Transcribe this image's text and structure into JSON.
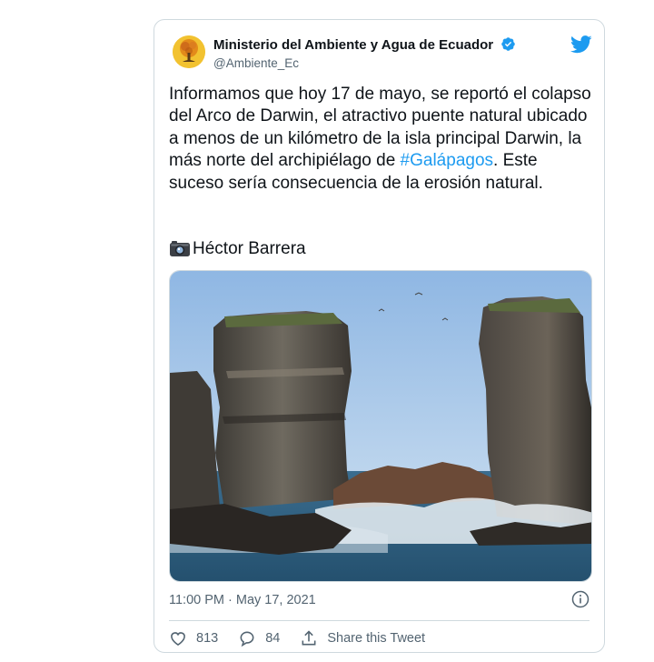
{
  "tweet": {
    "author_name": "Ministerio del Ambiente y Agua de Ecuador",
    "author_handle": "@Ambiente_Ec",
    "text_before": "Informamos que hoy 17 de mayo, se reportó el colapso del Arco de Darwin, el atractivo puente natural ubicado a menos de un kilómetro de la isla principal Darwin, la más norte del archipiélago de ",
    "hashtag": "#Galápagos",
    "text_after": ". Este suceso sería consecuencia de la erosión natural.",
    "photo_credit": "Héctor Barrera",
    "timestamp": "11:00 PM · May 17, 2021",
    "likes": "813",
    "replies": "84",
    "share_label": "Share this Tweet"
  },
  "icons": {
    "avatar": "tree-logo-icon",
    "verified": "verified-badge-icon",
    "brand": "twitter-bird-icon",
    "camera": "camera-icon",
    "info": "info-icon",
    "like": "heart-icon",
    "reply": "reply-bubble-icon",
    "share": "share-icon"
  },
  "colors": {
    "link": "#1d9bf0",
    "muted": "#536471",
    "border": "#cfd9de",
    "avatar_bg": "#f2c230"
  }
}
